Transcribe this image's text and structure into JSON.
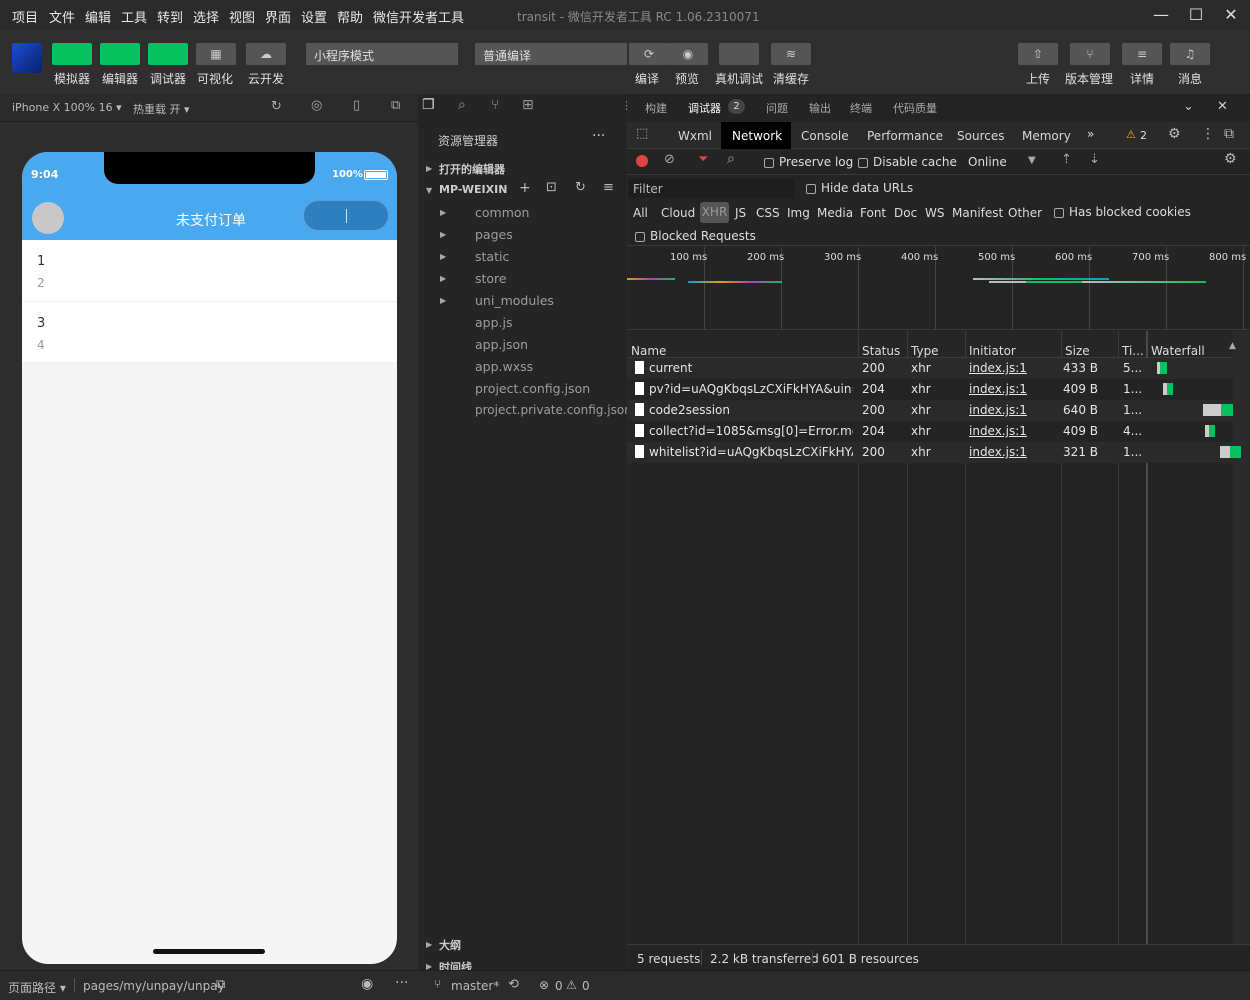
{
  "menubar": {
    "items": [
      "项目",
      "文件",
      "编辑",
      "工具",
      "转到",
      "选择",
      "视图",
      "界面",
      "设置",
      "帮助",
      "微信开发者工具"
    ],
    "title": "transit - 微信开发者工具 RC 1.06.2310071"
  },
  "toolbar": {
    "left": [
      "模拟器",
      "编辑器",
      "调试器",
      "可视化",
      "云开发"
    ],
    "mode": "小程序模式",
    "compile_mode": "普通编译",
    "mid": [
      "编译",
      "预览",
      "真机调试",
      "清缓存"
    ],
    "right": [
      "上传",
      "版本管理",
      "详情",
      "消息"
    ]
  },
  "simbar": {
    "device": "iPhone X 100% 16 ▾",
    "hotreload": "热重载 开 ▾"
  },
  "phone": {
    "time": "9:04",
    "battery": "100%",
    "title": "未支付订单",
    "items": [
      {
        "a": "1",
        "b": "2"
      },
      {
        "a": "3",
        "b": "4"
      }
    ]
  },
  "explorer": {
    "title": "资源管理器",
    "open_editors": "打开的编辑器",
    "root": "MP-WEIXIN",
    "folders": [
      "common",
      "pages",
      "static",
      "store",
      "uni_modules"
    ],
    "files": [
      "app.js",
      "app.json",
      "app.wxss",
      "project.config.json",
      "project.private.config.json"
    ],
    "outline": "大纲",
    "timeline": "时间线"
  },
  "devtop": {
    "tabs": [
      "构建",
      "调试器",
      "问题",
      "输出",
      "终端",
      "代码质量"
    ],
    "badge": "2"
  },
  "devtools": {
    "tabs": [
      "Wxml",
      "Network",
      "Console",
      "Performance",
      "Sources",
      "Memory"
    ],
    "warn_count": "2",
    "preserve_log": "Preserve log",
    "disable_cache": "Disable cache",
    "throttle": "Online",
    "filter_placeholder": "Filter",
    "hide_data_urls": "Hide data URLs",
    "types": [
      "All",
      "Cloud",
      "XHR",
      "JS",
      "CSS",
      "Img",
      "Media",
      "Font",
      "Doc",
      "WS",
      "Manifest",
      "Other"
    ],
    "blocked_cookies": "Has blocked cookies",
    "blocked_requests": "Blocked Requests",
    "timeline_ticks": [
      "100 ms",
      "200 ms",
      "300 ms",
      "400 ms",
      "500 ms",
      "600 ms",
      "700 ms",
      "800 ms"
    ],
    "columns": [
      "Name",
      "Status",
      "Type",
      "Initiator",
      "Size",
      "Ti...",
      "Waterfall"
    ],
    "rows": [
      {
        "name": "current",
        "status": "200",
        "type": "xhr",
        "initiator": "index.js:1",
        "size": "433 B",
        "time": "5..."
      },
      {
        "name": "pv?id=uAQgKbqsLzCXiFkHYA&uin=...",
        "status": "204",
        "type": "xhr",
        "initiator": "index.js:1",
        "size": "409 B",
        "time": "1..."
      },
      {
        "name": "code2session",
        "status": "200",
        "type": "xhr",
        "initiator": "index.js:1",
        "size": "640 B",
        "time": "1..."
      },
      {
        "name": "collect?id=1085&msg[0]=Error.mess...",
        "status": "204",
        "type": "xhr",
        "initiator": "index.js:1",
        "size": "409 B",
        "time": "4..."
      },
      {
        "name": "whitelist?id=uAQgKbqsLzCXiFkHYA...",
        "status": "200",
        "type": "xhr",
        "initiator": "index.js:1",
        "size": "321 B",
        "time": "1..."
      }
    ],
    "summary": [
      "5 requests",
      "2.2 kB transferred",
      "601 B resources"
    ]
  },
  "statusbar": {
    "path_label": "页面路径 ▾",
    "path": "pages/my/unpay/unpay",
    "branch": "master*",
    "errors": "0",
    "warnings": "0"
  },
  "colors": {
    "accent": "#07c160",
    "nav": "#49a8ee",
    "record": "#e04343"
  }
}
